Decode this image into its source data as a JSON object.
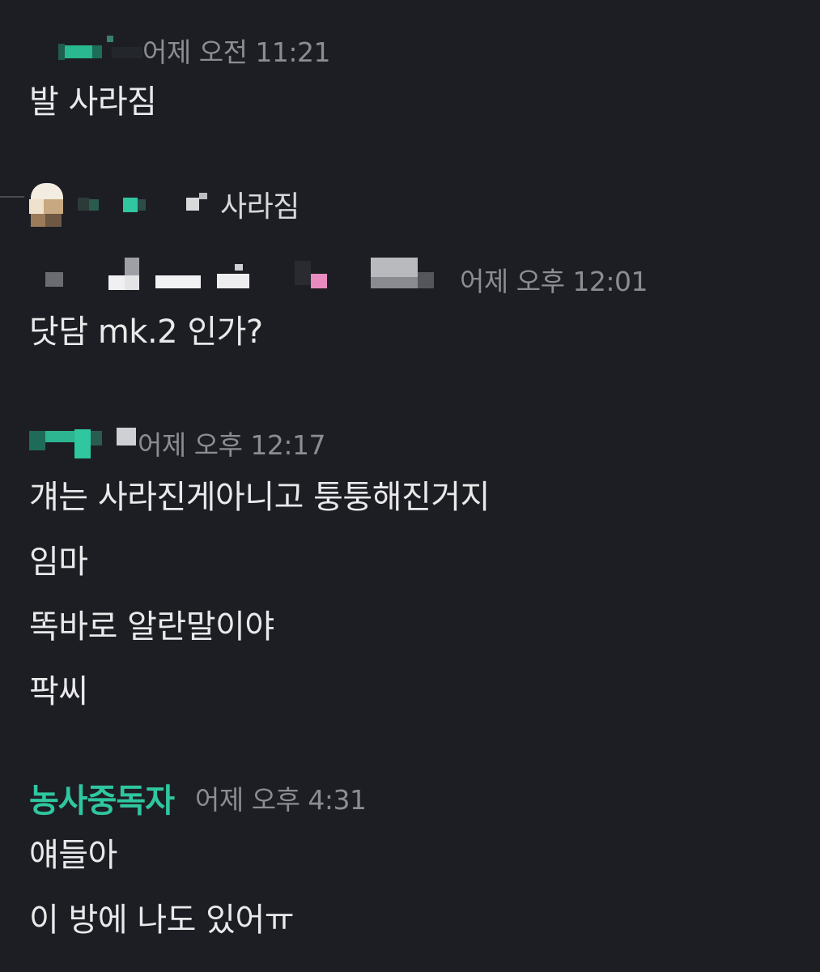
{
  "messages": [
    {
      "timestamp": "어제 오전 11:21",
      "lines": [
        "발 사라짐"
      ]
    },
    {
      "reply_preview": "사라짐",
      "timestamp": "어제 오후 12:01",
      "lines": [
        "닷담 mk.2 인가?"
      ]
    },
    {
      "timestamp": "어제 오후 12:17",
      "lines": [
        "걔는 사라진게아니고 퉁퉁해진거지",
        "임마",
        "똑바로 알란말이야",
        "팍씨"
      ]
    },
    {
      "username": "농사중독자",
      "timestamp": "어제 오후 4:31",
      "lines": [
        "얘들아",
        "이 방에 나도 있어ㅠ"
      ]
    }
  ],
  "colors": {
    "background": "#1d1e23",
    "username": "#2fc6a0",
    "timestamp": "#8b8d94",
    "text": "#e9e9eb"
  }
}
